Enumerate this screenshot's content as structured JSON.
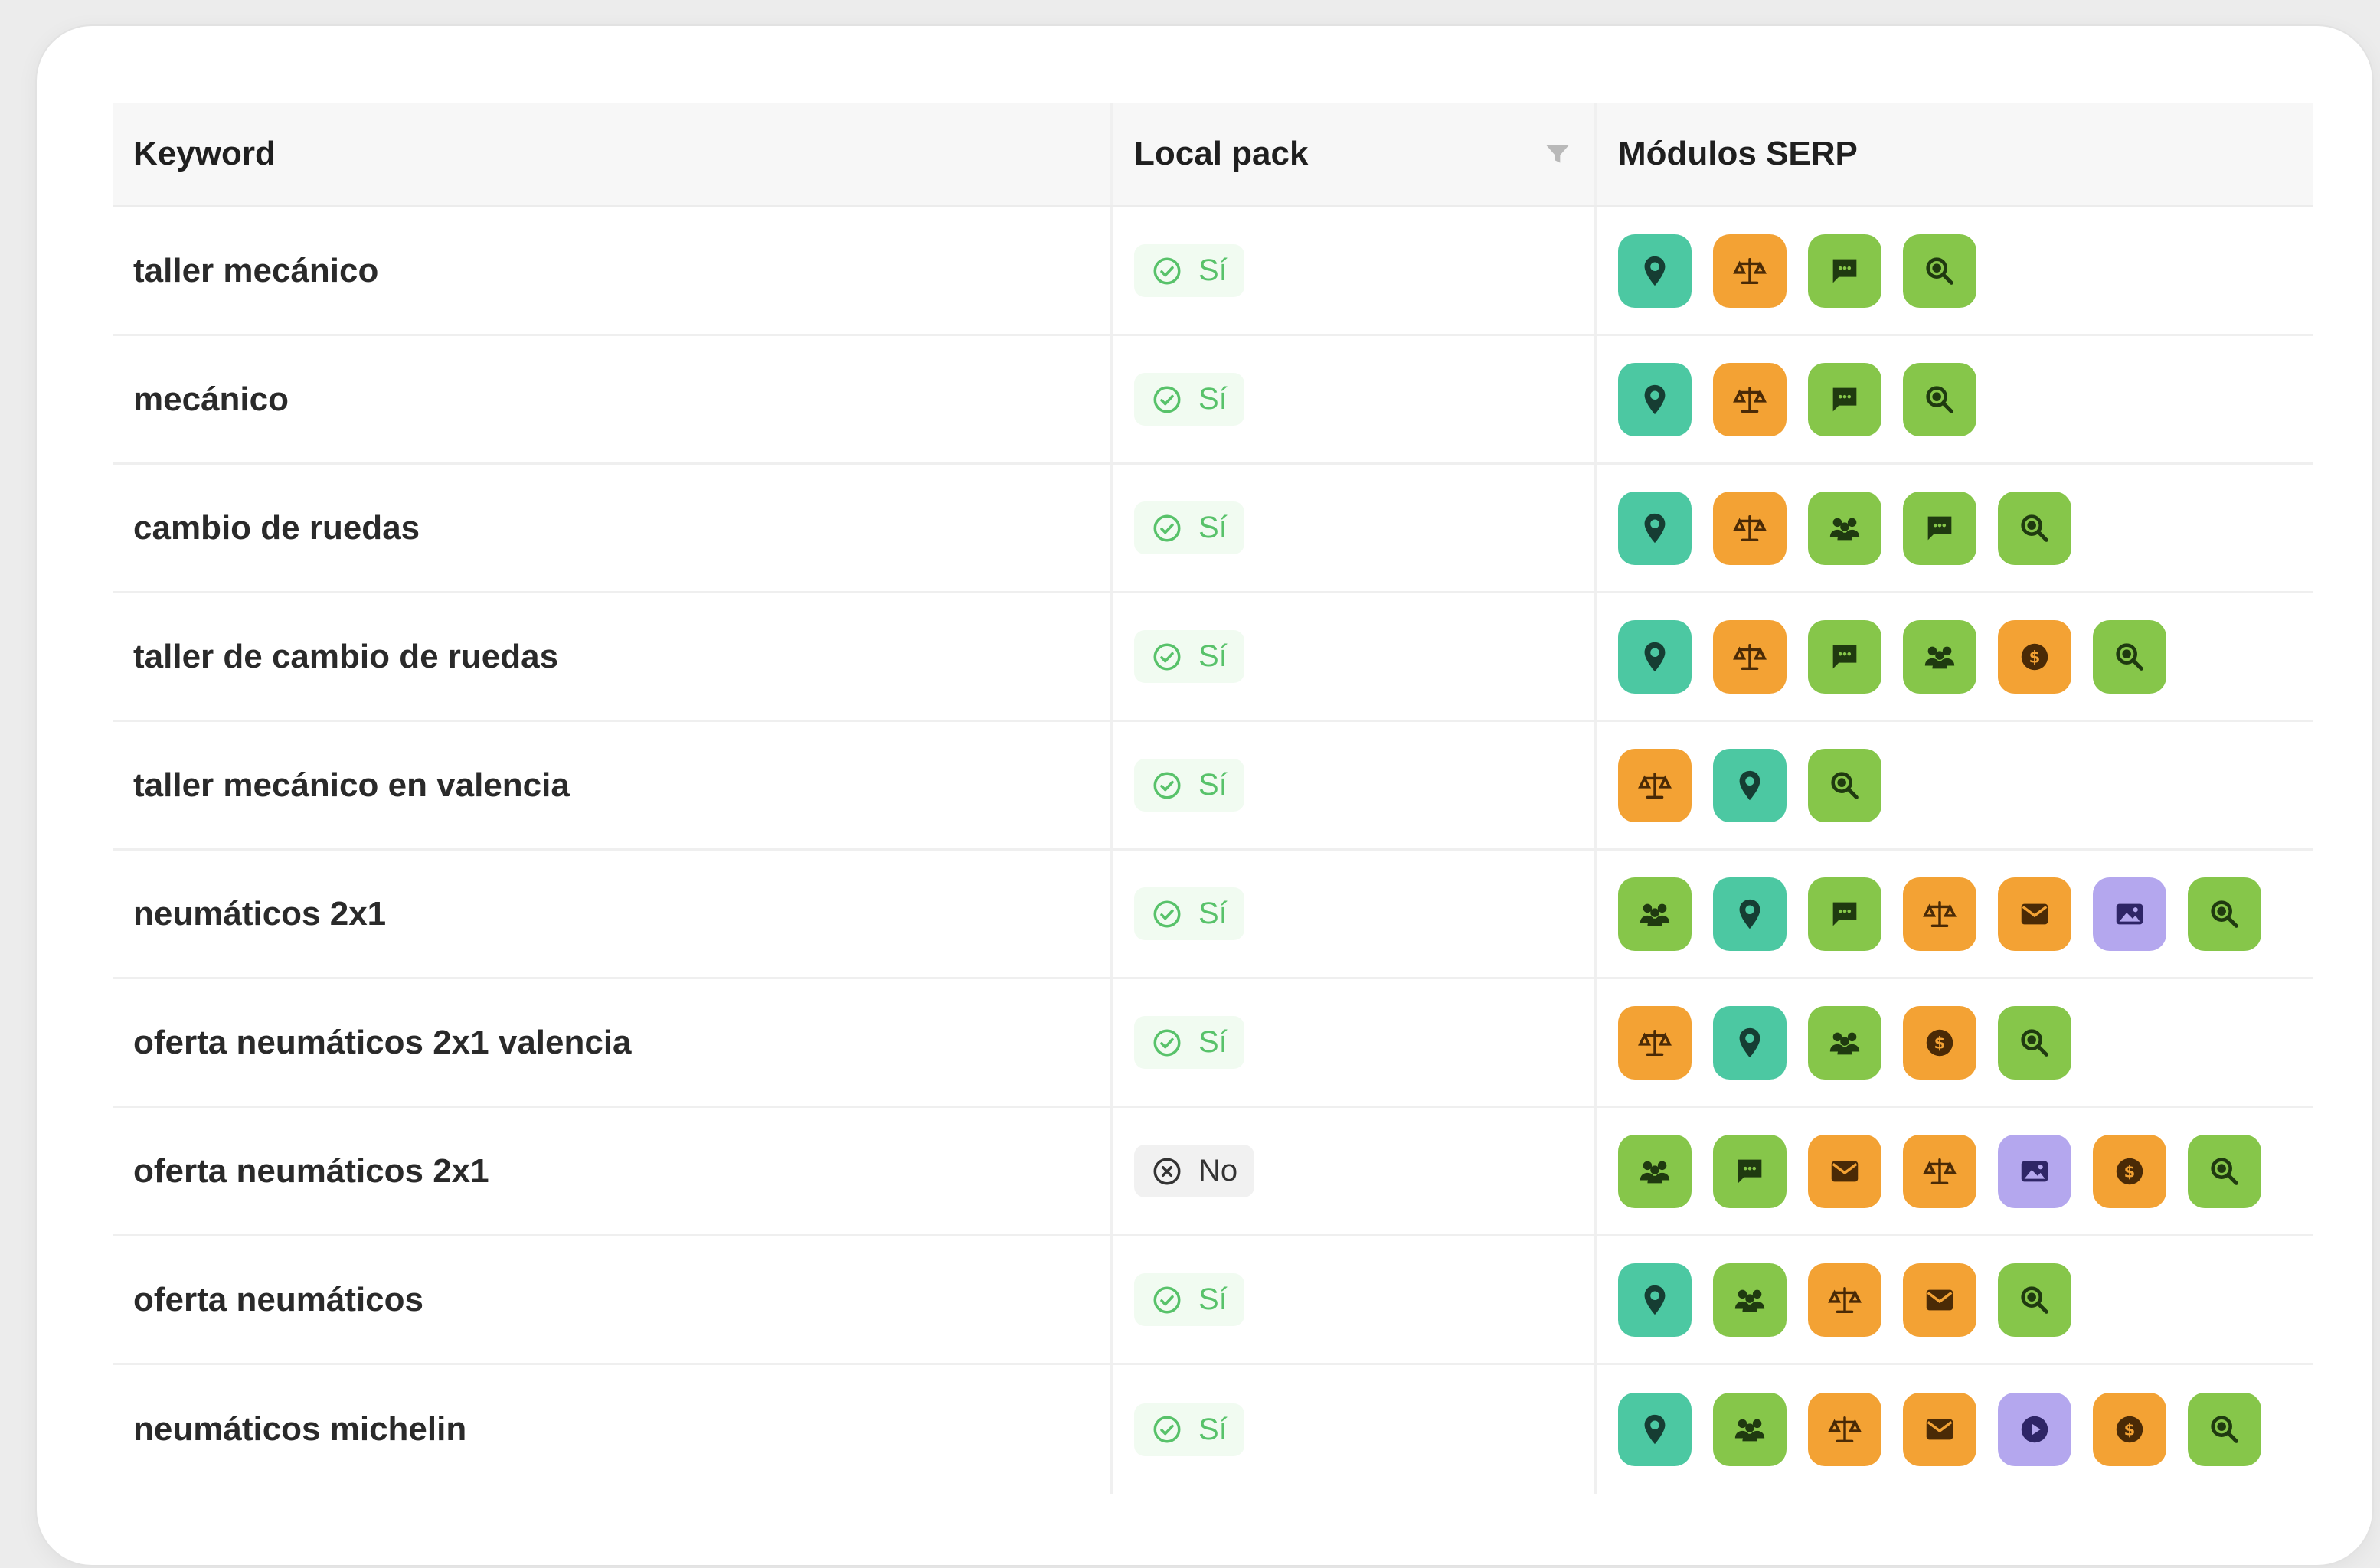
{
  "headers": {
    "keyword": "Keyword",
    "local_pack": "Local pack",
    "modules": "Módulos SERP"
  },
  "colors": {
    "map": "#4cc8a2",
    "orange": "#f3a234",
    "green": "#86c64a",
    "purple": "#b4a7ee",
    "yes_text": "#58c26a"
  },
  "rows": [
    {
      "keyword": "taller mecánico",
      "local_pack": "yes",
      "local_pack_label": "Sí",
      "modules": [
        "map-pin-icon",
        "scale-icon",
        "chat-icon",
        "search-icon"
      ]
    },
    {
      "keyword": "mecánico",
      "local_pack": "yes",
      "local_pack_label": "Sí",
      "modules": [
        "map-pin-icon",
        "scale-icon",
        "chat-icon",
        "search-icon"
      ]
    },
    {
      "keyword": "cambio de ruedas",
      "local_pack": "yes",
      "local_pack_label": "Sí",
      "modules": [
        "map-pin-icon",
        "scale-icon",
        "people-icon",
        "chat-icon",
        "search-icon"
      ]
    },
    {
      "keyword": "taller de cambio de ruedas",
      "local_pack": "yes",
      "local_pack_label": "Sí",
      "modules": [
        "map-pin-icon",
        "scale-icon",
        "chat-icon",
        "people-icon",
        "coin-icon",
        "search-icon"
      ]
    },
    {
      "keyword": "taller mecánico en valencia",
      "local_pack": "yes",
      "local_pack_label": "Sí",
      "modules": [
        "scale-icon",
        "map-pin-icon",
        "search-icon"
      ]
    },
    {
      "keyword": "neumáticos 2x1",
      "local_pack": "yes",
      "local_pack_label": "Sí",
      "modules": [
        "people-icon",
        "map-pin-icon",
        "chat-icon",
        "scale-icon",
        "mail-icon",
        "image-icon",
        "search-icon"
      ]
    },
    {
      "keyword": "oferta neumáticos 2x1 valencia",
      "local_pack": "yes",
      "local_pack_label": "Sí",
      "modules": [
        "scale-icon",
        "map-pin-icon",
        "people-icon",
        "coin-icon",
        "search-icon"
      ]
    },
    {
      "keyword": "oferta neumáticos 2x1",
      "local_pack": "no",
      "local_pack_label": "No",
      "modules": [
        "people-icon",
        "chat-icon",
        "mail-icon",
        "scale-icon",
        "image-icon",
        "coin-icon",
        "search-icon"
      ]
    },
    {
      "keyword": "oferta neumáticos",
      "local_pack": "yes",
      "local_pack_label": "Sí",
      "modules": [
        "map-pin-icon",
        "people-icon",
        "scale-icon",
        "mail-icon",
        "search-icon"
      ]
    },
    {
      "keyword": "neumáticos michelin",
      "local_pack": "yes",
      "local_pack_label": "Sí",
      "modules": [
        "map-pin-icon",
        "people-icon",
        "scale-icon",
        "mail-icon",
        "video-icon",
        "coin-icon",
        "search-icon"
      ]
    }
  ]
}
